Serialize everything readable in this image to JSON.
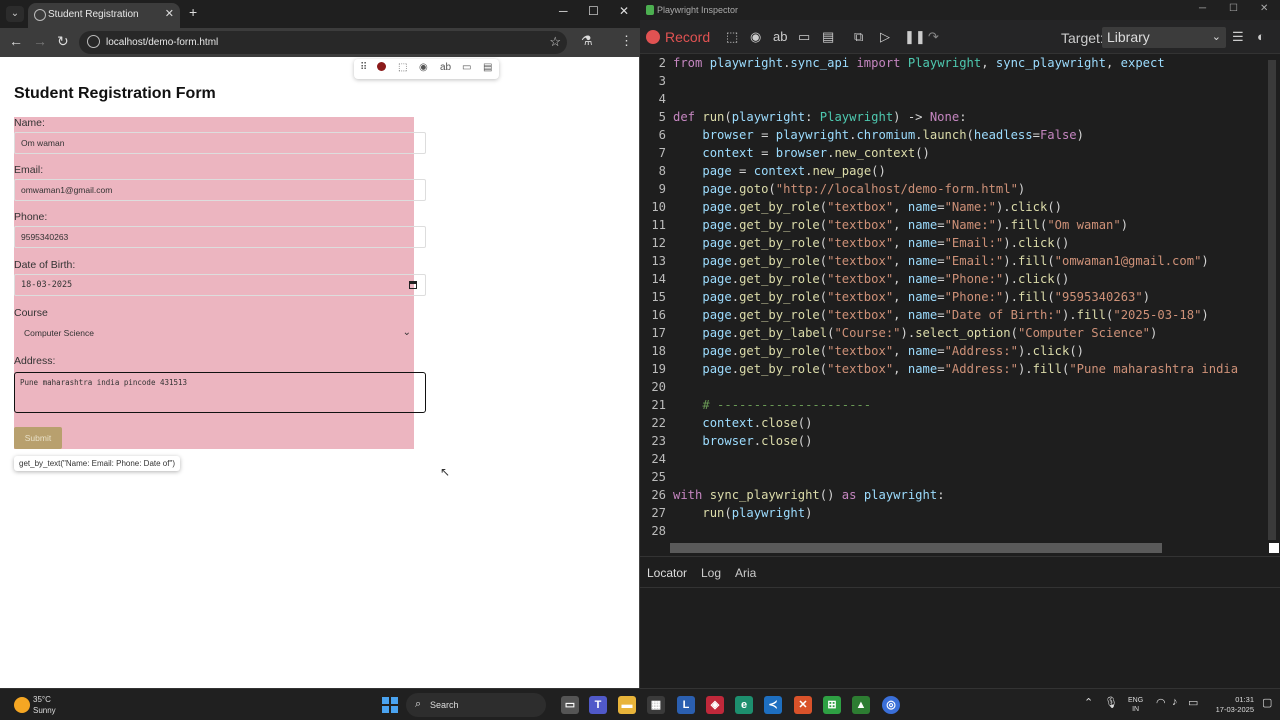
{
  "browser": {
    "tab_title": "Student Registration",
    "url": "localhost/demo-form.html"
  },
  "form": {
    "title": "Student Registration Form",
    "name_label": "Name:",
    "name_value": "Om waman",
    "email_label": "Email:",
    "email_value": "omwaman1@gmail.com",
    "phone_label": "Phone:",
    "phone_value": "9595340263",
    "dob_label": "Date of Birth:",
    "dob_value": "18-03-2025",
    "course_label": "Course",
    "course_value": "Computer Science",
    "address_label": "Address:",
    "address_value": "Pune maharashtra india pincode 431513",
    "submit_label": "Submit",
    "locator_tooltip": "get_by_text(\"Name: Email: Phone: Date of\")"
  },
  "inspector": {
    "window_title": "Playwright Inspector",
    "record_label": "Record",
    "target_label": "Target:",
    "target_value": "Library",
    "bottom_tabs": [
      "Locator",
      "Log",
      "Aria"
    ],
    "code_lines": [
      {
        "n": "2",
        "t": "from playwright.sync_api import Playwright, sync_playwright, expect"
      },
      {
        "n": "3",
        "t": ""
      },
      {
        "n": "4",
        "t": ""
      },
      {
        "n": "5",
        "t": "def run(playwright: Playwright) -> None:"
      },
      {
        "n": "6",
        "t": "    browser = playwright.chromium.launch(headless=False)"
      },
      {
        "n": "7",
        "t": "    context = browser.new_context()"
      },
      {
        "n": "8",
        "t": "    page = context.new_page()"
      },
      {
        "n": "9",
        "t": "    page.goto(\"http://localhost/demo-form.html\")"
      },
      {
        "n": "10",
        "t": "    page.get_by_role(\"textbox\", name=\"Name:\").click()"
      },
      {
        "n": "11",
        "t": "    page.get_by_role(\"textbox\", name=\"Name:\").fill(\"Om waman\")"
      },
      {
        "n": "12",
        "t": "    page.get_by_role(\"textbox\", name=\"Email:\").click()"
      },
      {
        "n": "13",
        "t": "    page.get_by_role(\"textbox\", name=\"Email:\").fill(\"omwaman1@gmail.com\")"
      },
      {
        "n": "14",
        "t": "    page.get_by_role(\"textbox\", name=\"Phone:\").click()"
      },
      {
        "n": "15",
        "t": "    page.get_by_role(\"textbox\", name=\"Phone:\").fill(\"9595340263\")"
      },
      {
        "n": "16",
        "t": "    page.get_by_role(\"textbox\", name=\"Date of Birth:\").fill(\"2025-03-18\")"
      },
      {
        "n": "17",
        "t": "    page.get_by_label(\"Course:\").select_option(\"Computer Science\")"
      },
      {
        "n": "18",
        "t": "    page.get_by_role(\"textbox\", name=\"Address:\").click()"
      },
      {
        "n": "19",
        "t": "    page.get_by_role(\"textbox\", name=\"Address:\").fill(\"Pune maharashtra india"
      },
      {
        "n": "20",
        "t": ""
      },
      {
        "n": "21",
        "t": "    # ---------------------"
      },
      {
        "n": "22",
        "t": "    context.close()"
      },
      {
        "n": "23",
        "t": "    browser.close()"
      },
      {
        "n": "24",
        "t": ""
      },
      {
        "n": "25",
        "t": ""
      },
      {
        "n": "26",
        "t": "with sync_playwright() as playwright:"
      },
      {
        "n": "27",
        "t": "    run(playwright)"
      },
      {
        "n": "28",
        "t": ""
      }
    ]
  },
  "taskbar": {
    "temperature": "35°C",
    "weather": "Sunny",
    "search_label": "Search",
    "lang_top": "ENG",
    "lang_bottom": "IN",
    "time": "01:31",
    "date": "17-03-2025"
  }
}
